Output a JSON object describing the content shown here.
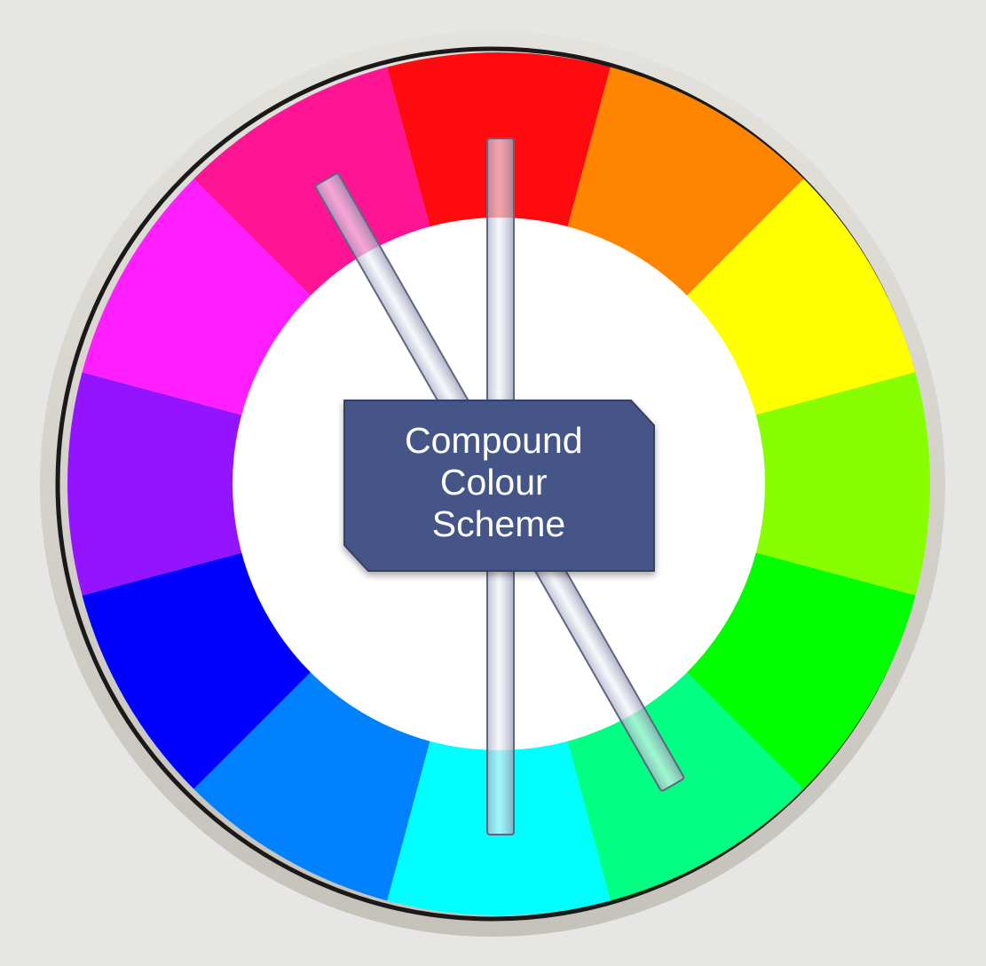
{
  "diagram": {
    "label_lines": [
      "Compound",
      "Colour",
      "Scheme"
    ],
    "segments": [
      {
        "name": "red",
        "color": "#ff0a0f"
      },
      {
        "name": "orange",
        "color": "#ff8500"
      },
      {
        "name": "yellow",
        "color": "#ffff00"
      },
      {
        "name": "yellow-green",
        "color": "#88ff00"
      },
      {
        "name": "green",
        "color": "#00ff00"
      },
      {
        "name": "spring-green",
        "color": "#00ff82"
      },
      {
        "name": "cyan",
        "color": "#00ffff"
      },
      {
        "name": "azure",
        "color": "#0082ff"
      },
      {
        "name": "blue",
        "color": "#0000ff"
      },
      {
        "name": "violet",
        "color": "#9414ff"
      },
      {
        "name": "magenta",
        "color": "#ff1eff"
      },
      {
        "name": "rose",
        "color": "#ff1494"
      }
    ],
    "colors": {
      "background": "#e6e6e4",
      "rim": "#d2d0c8",
      "rim_outline": "#1a1a1a",
      "label_box": "#445587",
      "label_text": "#ffffff",
      "center": "#ffffff"
    }
  }
}
